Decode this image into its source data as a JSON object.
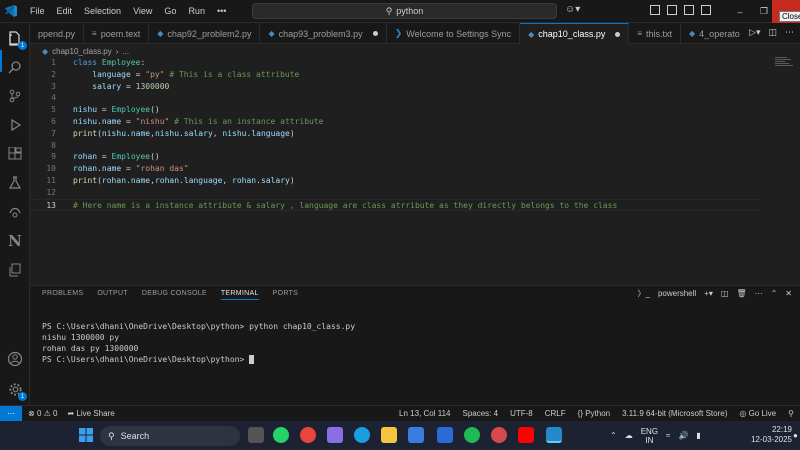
{
  "titlebar": {
    "menu": [
      "File",
      "Edit",
      "Selection",
      "View",
      "Go",
      "Run",
      "•••"
    ],
    "search": "python",
    "close_tooltip": "Close"
  },
  "tabs": [
    {
      "label": "ppend.py",
      "icon": "python"
    },
    {
      "label": "poem.text",
      "icon": "text"
    },
    {
      "label": "chap92_problem2.py",
      "icon": "python"
    },
    {
      "label": "chap93_problem3.py",
      "icon": "python",
      "dirty": true
    },
    {
      "label": "Welcome to Settings Sync",
      "icon": "vscode"
    },
    {
      "label": "chap10_class.py",
      "icon": "python",
      "dirty": true,
      "active": true
    },
    {
      "label": "this.txt",
      "icon": "text"
    },
    {
      "label": "4_operato",
      "icon": "python"
    }
  ],
  "breadcrumb": {
    "file": "chap10_class.py",
    "more": "..."
  },
  "editor": {
    "lines": [
      {
        "n": "1",
        "tokens": [
          [
            "kw",
            "class "
          ],
          [
            "cls",
            "Employee"
          ],
          [
            "op",
            ":"
          ]
        ]
      },
      {
        "n": "2",
        "tokens": [
          [
            "op",
            "    "
          ],
          [
            "var",
            "language"
          ],
          [
            "op",
            " = "
          ],
          [
            "str",
            "\"py\""
          ],
          [
            "cmt",
            " # This is a class attribute"
          ]
        ]
      },
      {
        "n": "3",
        "tokens": [
          [
            "op",
            "    "
          ],
          [
            "var",
            "salary"
          ],
          [
            "op",
            " = "
          ],
          [
            "num",
            "1300000"
          ]
        ]
      },
      {
        "n": "4",
        "tokens": []
      },
      {
        "n": "5",
        "tokens": [
          [
            "var",
            "nishu"
          ],
          [
            "op",
            " = "
          ],
          [
            "cls",
            "Employee"
          ],
          [
            "op",
            "()"
          ]
        ]
      },
      {
        "n": "6",
        "tokens": [
          [
            "var",
            "nishu"
          ],
          [
            "op",
            "."
          ],
          [
            "var",
            "name"
          ],
          [
            "op",
            " = "
          ],
          [
            "str",
            "\"nishu\""
          ],
          [
            "cmt",
            " # This is an instance attribute"
          ]
        ]
      },
      {
        "n": "7",
        "tokens": [
          [
            "fn",
            "print"
          ],
          [
            "op",
            "("
          ],
          [
            "var",
            "nishu"
          ],
          [
            "op",
            "."
          ],
          [
            "var",
            "name"
          ],
          [
            "op",
            ","
          ],
          [
            "var",
            "nishu"
          ],
          [
            "op",
            "."
          ],
          [
            "var",
            "salary"
          ],
          [
            "op",
            ", "
          ],
          [
            "var",
            "nishu"
          ],
          [
            "op",
            "."
          ],
          [
            "var",
            "language"
          ],
          [
            "op",
            ")"
          ]
        ]
      },
      {
        "n": "8",
        "tokens": []
      },
      {
        "n": "9",
        "tokens": [
          [
            "var",
            "rohan"
          ],
          [
            "op",
            " = "
          ],
          [
            "cls",
            "Employee"
          ],
          [
            "op",
            "()"
          ]
        ]
      },
      {
        "n": "10",
        "tokens": [
          [
            "var",
            "rohan"
          ],
          [
            "op",
            "."
          ],
          [
            "var",
            "name"
          ],
          [
            "op",
            " = "
          ],
          [
            "str",
            "\"rohan das\""
          ]
        ]
      },
      {
        "n": "11",
        "tokens": [
          [
            "fn",
            "print"
          ],
          [
            "op",
            "("
          ],
          [
            "var",
            "rohan"
          ],
          [
            "op",
            "."
          ],
          [
            "var",
            "name"
          ],
          [
            "op",
            ","
          ],
          [
            "var",
            "rohan"
          ],
          [
            "op",
            "."
          ],
          [
            "var",
            "language"
          ],
          [
            "op",
            ", "
          ],
          [
            "var",
            "rohan"
          ],
          [
            "op",
            "."
          ],
          [
            "var",
            "salary"
          ],
          [
            "op",
            ")"
          ]
        ]
      },
      {
        "n": "12",
        "tokens": []
      },
      {
        "n": "13",
        "tokens": [
          [
            "cmt",
            "# Here name is a instance attribute & salary , language are class atrribute as they directly belongs to the class"
          ]
        ],
        "current": true
      }
    ]
  },
  "panel": {
    "tabs": [
      "PROBLEMS",
      "OUTPUT",
      "DEBUG CONSOLE",
      "TERMINAL",
      "PORTS"
    ],
    "active_tab": "TERMINAL",
    "shell": "powershell",
    "terminal_lines": [
      "PS C:\\Users\\dhani\\OneDrive\\Desktop\\python> python chap10_class.py",
      "nishu 1300000 py",
      "rohan das py 1300000",
      "PS C:\\Users\\dhani\\OneDrive\\Desktop\\python> "
    ]
  },
  "status": {
    "errors": "0",
    "warnings": "0",
    "live_share": "Live Share",
    "position": "Ln 13, Col 114",
    "spaces": "Spaces: 4",
    "encoding": "UTF-8",
    "eol": "CRLF",
    "language": "Python",
    "interpreter": "3.11.9 64-bit (Microsoft Store)",
    "go_live": "Go Live"
  },
  "taskbar": {
    "search": "Search",
    "lang_top": "ENG",
    "lang_bottom": "IN",
    "time": "22:19",
    "date": "12-03-2025"
  },
  "colors": {
    "accent": "#0078d4",
    "close": "#c42b1c"
  }
}
